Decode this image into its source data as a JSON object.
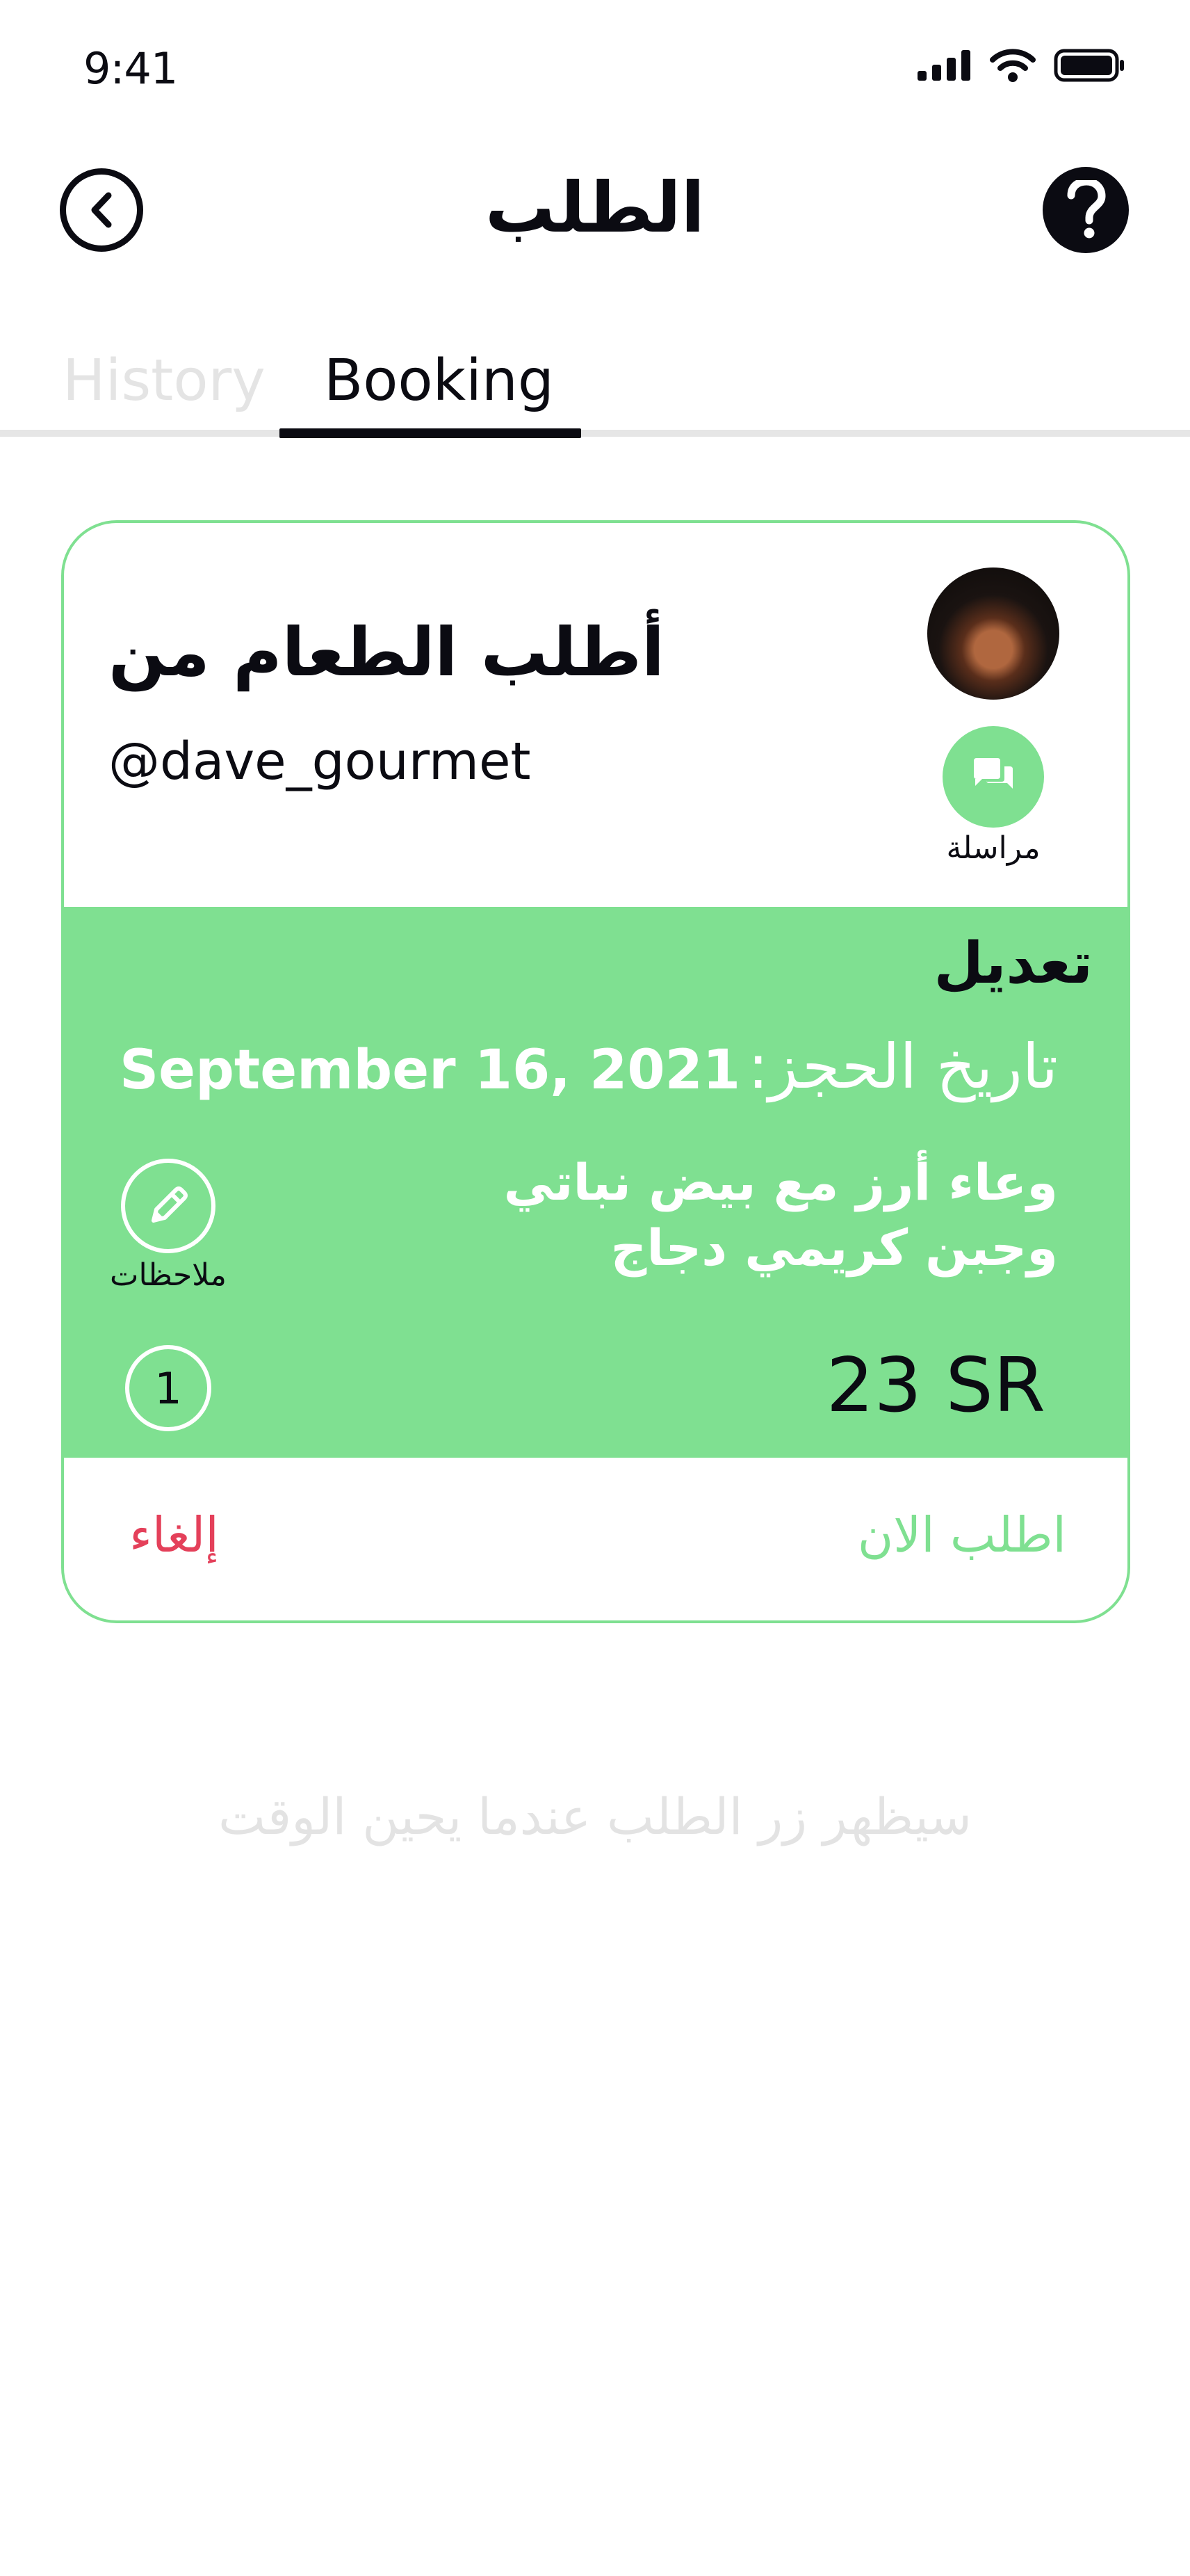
{
  "status_bar": {
    "time": "9:41"
  },
  "header": {
    "title": "الطلب"
  },
  "tabs": [
    {
      "label": "History",
      "active": false
    },
    {
      "label": "Booking",
      "active": true
    }
  ],
  "card": {
    "title": "أطلب الطعام من",
    "handle": "@dave_gourmet",
    "chat_label": "مراسلة",
    "edit_label": "تعديل",
    "date_label": "تاريخ الحجز:",
    "date_value": "September 16, 2021",
    "item_description": "وعاء أرز مع بيض نباتي وجبن كريمي دجاج",
    "notes_label": "ملاحظات",
    "quantity": "1",
    "price": "23 SR",
    "cancel_label": "إلغاء",
    "order_now_label": "اطلب الان"
  },
  "footer_hint": "سيظهر زر الطلب عندما يحين الوقت",
  "colors": {
    "accent_green": "#7fe091",
    "cancel_red": "#e4405a",
    "text_dark": "#0b0b12",
    "muted_gray": "#e3e3e3"
  }
}
